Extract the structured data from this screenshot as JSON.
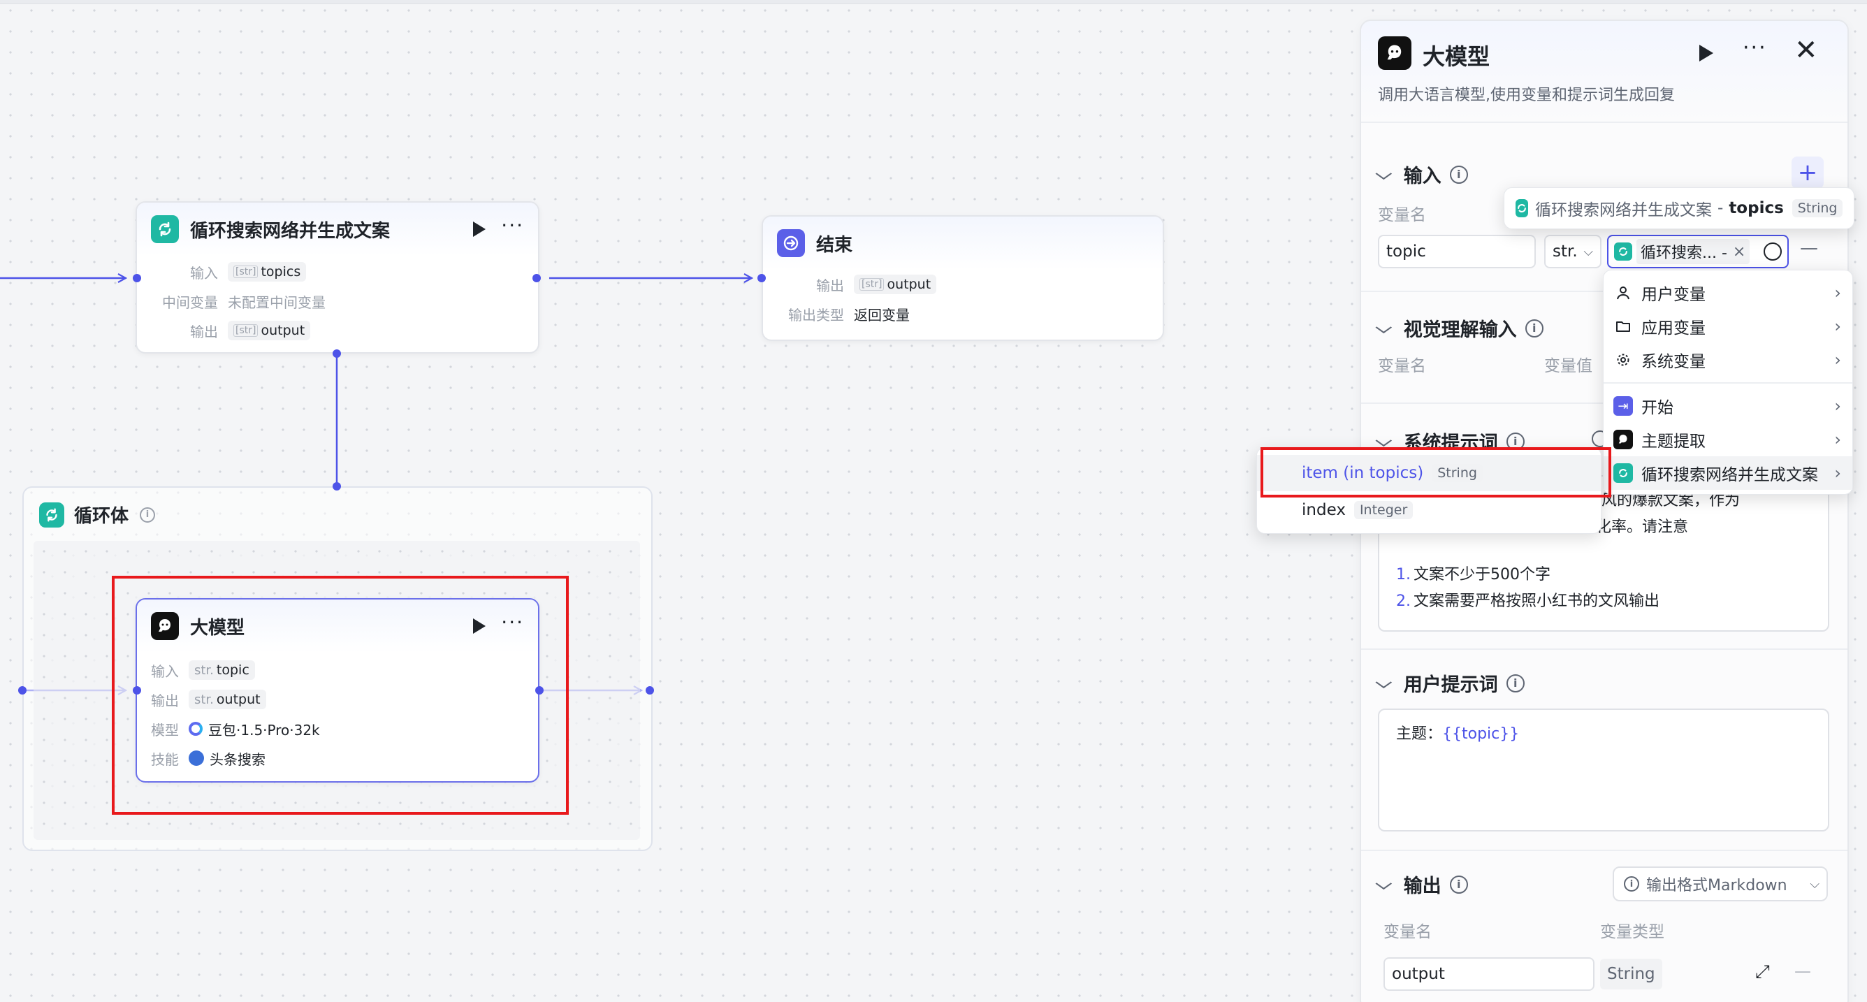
{
  "canvas": {
    "node_loop": {
      "title": "循环搜索网络并生成文案",
      "rows": [
        {
          "label": "输入",
          "type": "[str]",
          "value": "topics"
        },
        {
          "label": "中间变量",
          "value": "未配置中间变量"
        },
        {
          "label": "输出",
          "type": "[str]",
          "value": "output"
        }
      ]
    },
    "node_end": {
      "title": "结束",
      "rows": [
        {
          "label": "输出",
          "type": "[str]",
          "value": "output"
        },
        {
          "label": "输出类型",
          "value": "返回变量"
        }
      ]
    },
    "loop_body": {
      "title": "循环体"
    },
    "node_llm": {
      "title": "大模型",
      "rows": [
        {
          "label": "输入",
          "type": "str.",
          "value": "topic"
        },
        {
          "label": "输出",
          "type": "str.",
          "value": "output"
        },
        {
          "label": "模型",
          "value": "豆包·1.5·Pro·32k"
        },
        {
          "label": "技能",
          "value": "头条搜索"
        }
      ]
    }
  },
  "panel": {
    "title": "大模型",
    "description": "调用大语言模型,使用变量和提示词生成回复",
    "input_section": {
      "title": "输入",
      "var_name_label": "变量名",
      "var_name_value": "topic",
      "type_select": "str.",
      "ref_value": "循环搜索... - ",
      "ref_clear": "×",
      "add_button": "+",
      "remove_button": "—"
    },
    "vision_section": {
      "title": "视觉理解输入",
      "var_name_label": "变量名",
      "var_value_label": "变量值"
    },
    "system_prompt": {
      "title": "系统提示词",
      "line1": "红书文风的爆款文案，作为",
      "line2": "软广内容，提升产品销售的转化率。请注意",
      "list": [
        "文案不少于500个字",
        "文案需要严格按照小红书的文风输出"
      ]
    },
    "user_prompt": {
      "title": "用户提示词",
      "prefix": "主题：",
      "var": "{{topic}}"
    },
    "output_section": {
      "title": "输出",
      "format_select": "输出格式Markdown",
      "var_name_label": "变量名",
      "var_type_label": "变量类型",
      "var_name_value": "output",
      "var_type_value": "String"
    }
  },
  "tooltip": {
    "node": "循环搜索网络并生成文案",
    "sep": "-",
    "var": "topics",
    "type": "String"
  },
  "var_menu": {
    "items": [
      "用户变量",
      "应用变量",
      "系统变量",
      "开始",
      "主题提取",
      "循环搜索网络并生成文案"
    ]
  },
  "sub_menu": {
    "items": [
      {
        "name": "item (in topics)",
        "type": "String"
      },
      {
        "name": "index",
        "type": "Integer"
      }
    ]
  },
  "colors": {
    "accent": "#4d53e8",
    "loop_icon": "#1fb8a3",
    "highlight": "#e8191c"
  }
}
